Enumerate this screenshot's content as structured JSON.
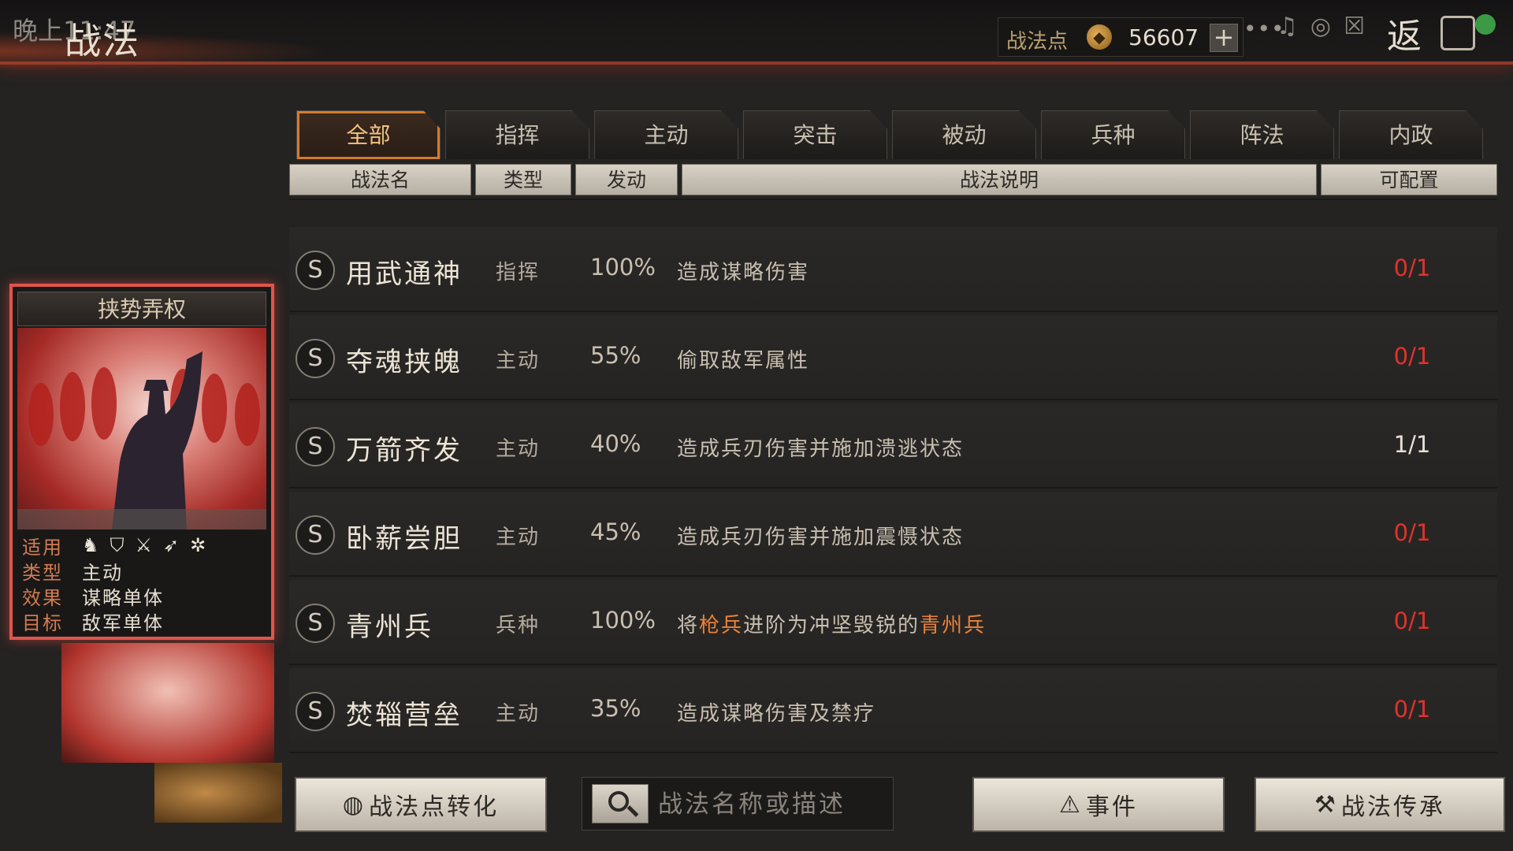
{
  "status_bar": {
    "clock": "晚上11:47"
  },
  "header": {
    "title": "战法",
    "points_label": "战法点",
    "points_value": "56607",
    "plus": "+",
    "dots": "•••",
    "return_label": "返"
  },
  "tabs": [
    {
      "label": "全部",
      "active": true
    },
    {
      "label": "指挥"
    },
    {
      "label": "主动"
    },
    {
      "label": "突击"
    },
    {
      "label": "被动"
    },
    {
      "label": "兵种"
    },
    {
      "label": "阵法"
    },
    {
      "label": "内政"
    }
  ],
  "columns": [
    "战法名",
    "类型",
    "发动",
    "战法说明",
    "可配置"
  ],
  "rows": [
    {
      "rank": "S",
      "name": "用武通神",
      "type": "指挥",
      "rate": "100%",
      "desc": "造成谋略伤害",
      "config": "0/1",
      "config_color": "#e0332c"
    },
    {
      "rank": "S",
      "name": "夺魂挟魄",
      "type": "主动",
      "rate": "55%",
      "desc": "偷取敌军属性",
      "config": "0/1",
      "config_color": "#e0332c"
    },
    {
      "rank": "S",
      "name": "万箭齐发",
      "type": "主动",
      "rate": "40%",
      "desc": "造成兵刃伤害并施加溃逃状态",
      "config": "1/1",
      "config_color": "#e7e0d4"
    },
    {
      "rank": "S",
      "name": "卧薪尝胆",
      "type": "主动",
      "rate": "45%",
      "desc": "造成兵刃伤害并施加震慑状态",
      "config": "0/1",
      "config_color": "#e0332c"
    },
    {
      "rank": "S",
      "name": "青州兵",
      "type": "兵种",
      "rate": "100%",
      "desc_parts": [
        "将",
        "枪兵",
        "进阶为冲坚毁锐的",
        "青州兵"
      ],
      "config": "0/1",
      "config_color": "#e0332c"
    },
    {
      "rank": "S",
      "name": "焚辎营垒",
      "type": "主动",
      "rate": "35%",
      "desc": "造成谋略伤害及禁疗",
      "config": "0/1",
      "config_color": "#e0332c"
    }
  ],
  "preview_card": {
    "title": "挟势弄权",
    "apply_label": "适用",
    "apply_icons": [
      "cavalry-icon",
      "shield-icon",
      "crossed-swords-icon",
      "bow-icon",
      "wheel-icon"
    ],
    "type_label": "类型",
    "type_value": "主动",
    "effect_label": "效果",
    "effect_value": "谋略单体",
    "target_label": "目标",
    "target_value": "敌军单体"
  },
  "bottom": {
    "convert_label": "战法点转化",
    "search_placeholder": "战法名称或描述",
    "event_label": "事件",
    "inherit_label": "战法传承"
  },
  "colors": {
    "accent_orange": "#d37c2d",
    "highlight": "#e7823a",
    "config_red": "#e0332c"
  }
}
